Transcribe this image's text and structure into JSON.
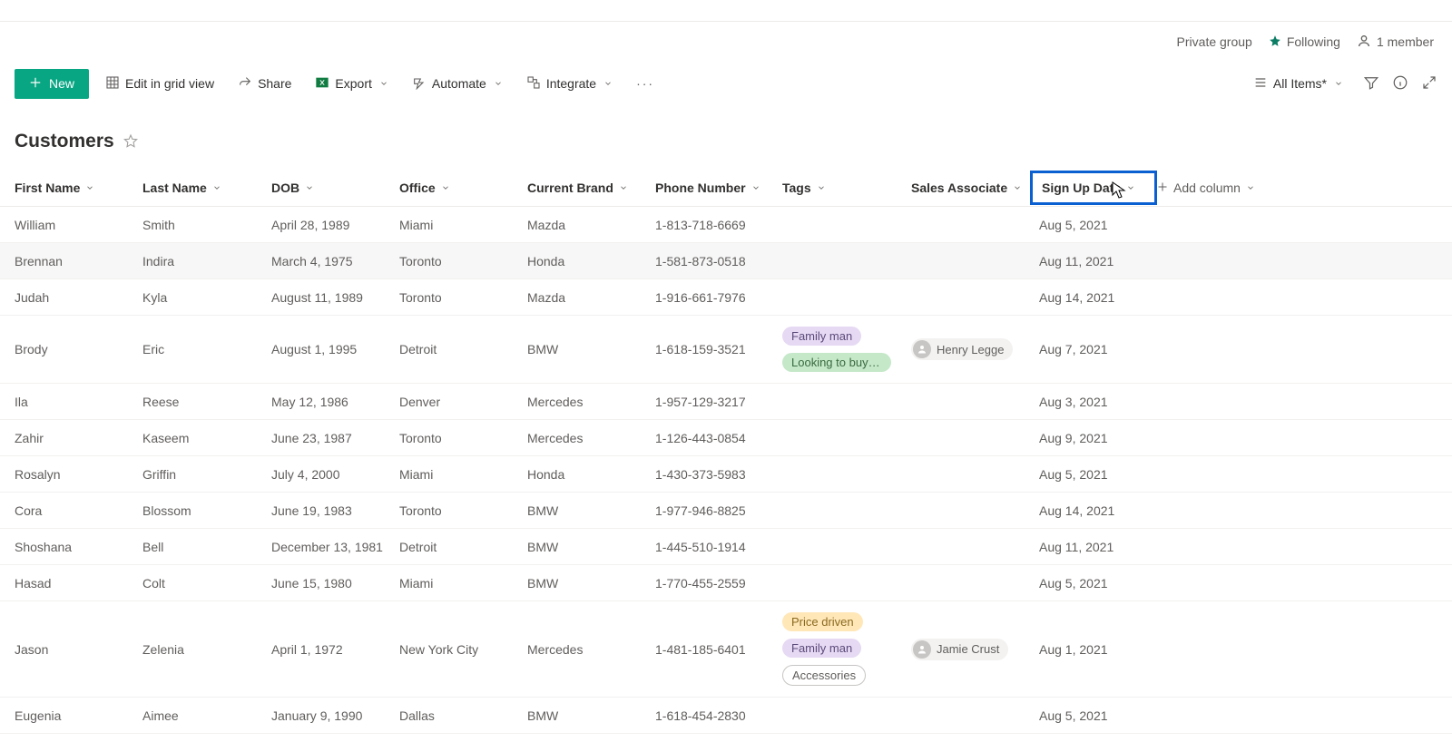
{
  "header": {
    "private_group": "Private group",
    "following": "Following",
    "member_count": "1 member"
  },
  "toolbar": {
    "new_label": "New",
    "edit_label": "Edit in grid view",
    "share_label": "Share",
    "export_label": "Export",
    "automate_label": "Automate",
    "integrate_label": "Integrate",
    "view_label": "All Items*"
  },
  "list": {
    "title": "Customers"
  },
  "columns": {
    "first_name": "First Name",
    "last_name": "Last Name",
    "dob": "DOB",
    "office": "Office",
    "current_brand": "Current Brand",
    "phone": "Phone Number",
    "tags": "Tags",
    "sales_assoc": "Sales Associate",
    "sign_up": "Sign Up Date",
    "add_column": "Add column"
  },
  "rows": [
    {
      "first": "William",
      "last": "Smith",
      "dob": "April 28, 1989",
      "office": "Miami",
      "brand": "Mazda",
      "phone": "1-813-718-6669",
      "tags": [],
      "assoc": "",
      "sign": "Aug 5, 2021"
    },
    {
      "first": "Brennan",
      "last": "Indira",
      "dob": "March 4, 1975",
      "office": "Toronto",
      "brand": "Honda",
      "phone": "1-581-873-0518",
      "tags": [],
      "assoc": "",
      "sign": "Aug 11, 2021"
    },
    {
      "first": "Judah",
      "last": "Kyla",
      "dob": "August 11, 1989",
      "office": "Toronto",
      "brand": "Mazda",
      "phone": "1-916-661-7976",
      "tags": [],
      "assoc": "",
      "sign": "Aug 14, 2021"
    },
    {
      "first": "Brody",
      "last": "Eric",
      "dob": "August 1, 1995",
      "office": "Detroit",
      "brand": "BMW",
      "phone": "1-618-159-3521",
      "tags": [
        {
          "t": "Family man",
          "c": "purple"
        },
        {
          "t": "Looking to buy s…",
          "c": "green"
        }
      ],
      "assoc": "Henry Legge",
      "sign": "Aug 7, 2021"
    },
    {
      "first": "Ila",
      "last": "Reese",
      "dob": "May 12, 1986",
      "office": "Denver",
      "brand": "Mercedes",
      "phone": "1-957-129-3217",
      "tags": [],
      "assoc": "",
      "sign": "Aug 3, 2021"
    },
    {
      "first": "Zahir",
      "last": "Kaseem",
      "dob": "June 23, 1987",
      "office": "Toronto",
      "brand": "Mercedes",
      "phone": "1-126-443-0854",
      "tags": [],
      "assoc": "",
      "sign": "Aug 9, 2021"
    },
    {
      "first": "Rosalyn",
      "last": "Griffin",
      "dob": "July 4, 2000",
      "office": "Miami",
      "brand": "Honda",
      "phone": "1-430-373-5983",
      "tags": [],
      "assoc": "",
      "sign": "Aug 5, 2021"
    },
    {
      "first": "Cora",
      "last": "Blossom",
      "dob": "June 19, 1983",
      "office": "Toronto",
      "brand": "BMW",
      "phone": "1-977-946-8825",
      "tags": [],
      "assoc": "",
      "sign": "Aug 14, 2021"
    },
    {
      "first": "Shoshana",
      "last": "Bell",
      "dob": "December 13, 1981",
      "office": "Detroit",
      "brand": "BMW",
      "phone": "1-445-510-1914",
      "tags": [],
      "assoc": "",
      "sign": "Aug 11, 2021"
    },
    {
      "first": "Hasad",
      "last": "Colt",
      "dob": "June 15, 1980",
      "office": "Miami",
      "brand": "BMW",
      "phone": "1-770-455-2559",
      "tags": [],
      "assoc": "",
      "sign": "Aug 5, 2021"
    },
    {
      "first": "Jason",
      "last": "Zelenia",
      "dob": "April 1, 1972",
      "office": "New York City",
      "brand": "Mercedes",
      "phone": "1-481-185-6401",
      "tags": [
        {
          "t": "Price driven",
          "c": "orange"
        },
        {
          "t": "Family man",
          "c": "purple"
        },
        {
          "t": "Accessories",
          "c": "outline"
        }
      ],
      "assoc": "Jamie Crust",
      "sign": "Aug 1, 2021"
    },
    {
      "first": "Eugenia",
      "last": "Aimee",
      "dob": "January 9, 1990",
      "office": "Dallas",
      "brand": "BMW",
      "phone": "1-618-454-2830",
      "tags": [],
      "assoc": "",
      "sign": "Aug 5, 2021"
    }
  ]
}
